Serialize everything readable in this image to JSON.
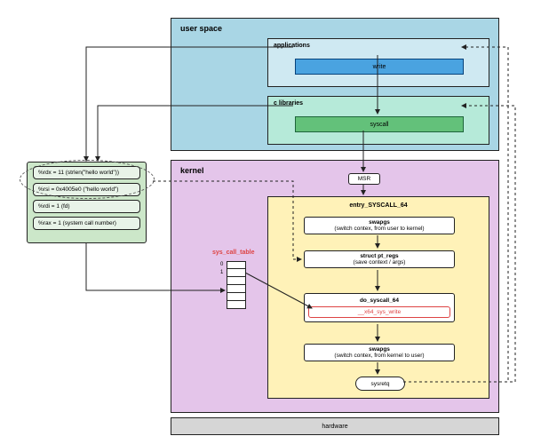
{
  "userspace": {
    "title": "user space",
    "applications": {
      "label": "applications",
      "box": "write"
    },
    "clibs": {
      "label": "c libraries",
      "box": "syscall"
    }
  },
  "kernel": {
    "title": "kernel",
    "msr": "MSR",
    "entry": {
      "title": "entry_SYSCALL_64",
      "swapgs_in": {
        "title": "swapgs",
        "sub": "(switch contex, from user to kernel)"
      },
      "ptregs": {
        "title": "struct pt_regs",
        "sub": "(save context / args)"
      },
      "do_syscall": {
        "title": "do_syscall_64",
        "inner": "__x64_sys_write"
      },
      "swapgs_out": {
        "title": "swapgs",
        "sub": "(switch contex, from kernel to user)"
      },
      "sysretq": "sysretq"
    },
    "sct": {
      "label": "sys_call_table",
      "idx0": "0",
      "idx1": "1"
    }
  },
  "regs": {
    "rdx": "%rdx = 11 (strlen(\"hello world\"))",
    "rsi": "%rsi = 0x4005e0 (\"hello world\")",
    "rdi": "%rdi = 1 (fd)",
    "rax": "%rax = 1 (system call number)"
  },
  "hardware": "hardware"
}
